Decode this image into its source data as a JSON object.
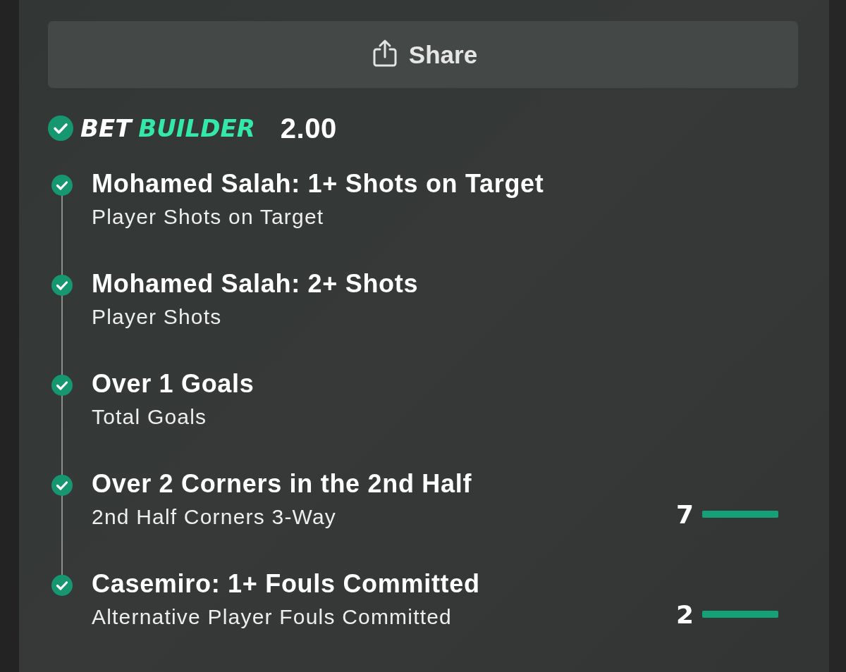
{
  "share_button": {
    "label": "Share"
  },
  "bet_builder": {
    "settled": true,
    "title_first": "BET",
    "title_second": "BUILDER",
    "odds": "2.00"
  },
  "legs": [
    {
      "title": "Mohamed Salah: 1+ Shots on Target",
      "market": "Player Shots on Target",
      "won": true
    },
    {
      "title": "Mohamed Salah: 2+ Shots",
      "market": "Player Shots",
      "won": true
    },
    {
      "title": "Over 1 Goals",
      "market": "Total Goals",
      "won": true
    },
    {
      "title": "Over 2 Corners in the 2nd Half",
      "market": "2nd Half Corners 3-Way",
      "won": true,
      "tracker": {
        "count": "7",
        "level": 1
      }
    },
    {
      "title": "Casemiro: 1+ Fouls Committed",
      "market": "Alternative Player Fouls Committed",
      "won": true,
      "tracker": {
        "count": "2",
        "level": 1
      }
    }
  ]
}
